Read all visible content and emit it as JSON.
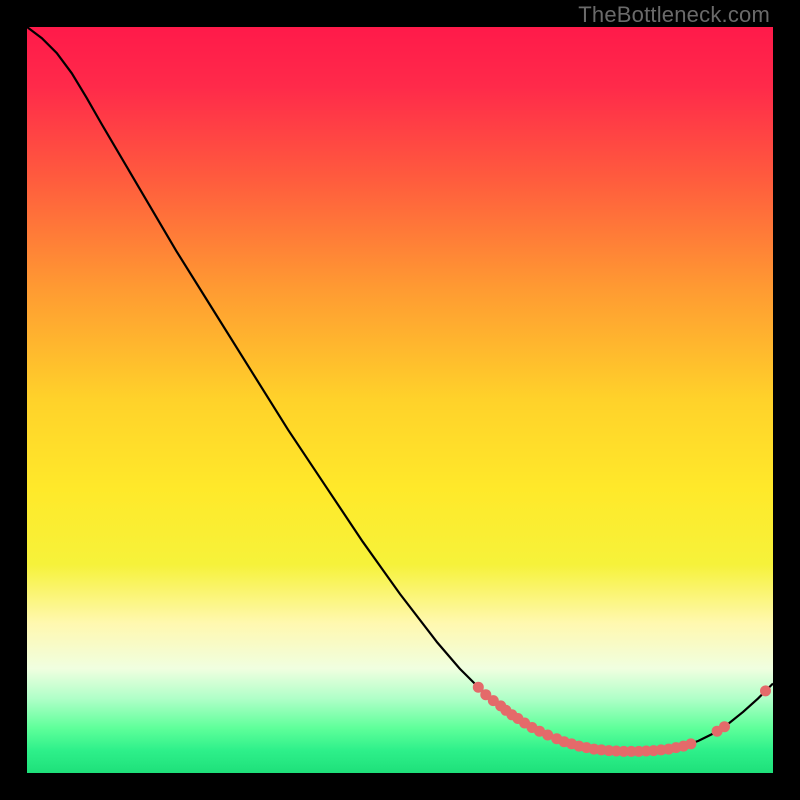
{
  "watermark": "TheBottleneck.com",
  "chart_data": {
    "type": "line",
    "title": "",
    "xlabel": "",
    "ylabel": "",
    "xlim": [
      0,
      100
    ],
    "ylim": [
      0,
      100
    ],
    "grid": false,
    "gradient_stops": [
      {
        "offset": 0.0,
        "color": "#ff1a4a"
      },
      {
        "offset": 0.08,
        "color": "#ff2a4a"
      },
      {
        "offset": 0.2,
        "color": "#ff5a3e"
      },
      {
        "offset": 0.35,
        "color": "#ff9a32"
      },
      {
        "offset": 0.5,
        "color": "#ffd22a"
      },
      {
        "offset": 0.62,
        "color": "#ffe92a"
      },
      {
        "offset": 0.72,
        "color": "#f6f23a"
      },
      {
        "offset": 0.8,
        "color": "#fff8b0"
      },
      {
        "offset": 0.86,
        "color": "#f0ffe0"
      },
      {
        "offset": 0.9,
        "color": "#b0ffc8"
      },
      {
        "offset": 0.94,
        "color": "#5eff9a"
      },
      {
        "offset": 0.97,
        "color": "#2ef08a"
      },
      {
        "offset": 1.0,
        "color": "#1ee07a"
      }
    ],
    "series": [
      {
        "name": "curve",
        "points": [
          {
            "x": 0.0,
            "y": 100.0
          },
          {
            "x": 2.0,
            "y": 98.5
          },
          {
            "x": 4.0,
            "y": 96.5
          },
          {
            "x": 6.0,
            "y": 93.8
          },
          {
            "x": 8.0,
            "y": 90.5
          },
          {
            "x": 10.0,
            "y": 87.0
          },
          {
            "x": 15.0,
            "y": 78.5
          },
          {
            "x": 20.0,
            "y": 70.0
          },
          {
            "x": 25.0,
            "y": 62.0
          },
          {
            "x": 30.0,
            "y": 54.0
          },
          {
            "x": 35.0,
            "y": 46.0
          },
          {
            "x": 40.0,
            "y": 38.5
          },
          {
            "x": 45.0,
            "y": 31.0
          },
          {
            "x": 50.0,
            "y": 24.0
          },
          {
            "x": 55.0,
            "y": 17.5
          },
          {
            "x": 58.0,
            "y": 14.0
          },
          {
            "x": 60.0,
            "y": 12.0
          },
          {
            "x": 62.0,
            "y": 10.2
          },
          {
            "x": 64.0,
            "y": 8.6
          },
          {
            "x": 66.0,
            "y": 7.2
          },
          {
            "x": 68.0,
            "y": 6.0
          },
          {
            "x": 70.0,
            "y": 5.0
          },
          {
            "x": 72.0,
            "y": 4.2
          },
          {
            "x": 74.0,
            "y": 3.6
          },
          {
            "x": 76.0,
            "y": 3.2
          },
          {
            "x": 78.0,
            "y": 3.0
          },
          {
            "x": 80.0,
            "y": 2.9
          },
          {
            "x": 82.0,
            "y": 2.9
          },
          {
            "x": 84.0,
            "y": 3.0
          },
          {
            "x": 86.0,
            "y": 3.2
          },
          {
            "x": 88.0,
            "y": 3.6
          },
          {
            "x": 90.0,
            "y": 4.3
          },
          {
            "x": 92.0,
            "y": 5.3
          },
          {
            "x": 94.0,
            "y": 6.6
          },
          {
            "x": 96.0,
            "y": 8.2
          },
          {
            "x": 98.0,
            "y": 10.0
          },
          {
            "x": 100.0,
            "y": 12.0
          }
        ]
      }
    ],
    "markers": [
      {
        "x": 60.5,
        "y": 11.5
      },
      {
        "x": 61.5,
        "y": 10.5
      },
      {
        "x": 62.5,
        "y": 9.7
      },
      {
        "x": 63.5,
        "y": 9.0
      },
      {
        "x": 64.2,
        "y": 8.4
      },
      {
        "x": 65.0,
        "y": 7.8
      },
      {
        "x": 65.8,
        "y": 7.3
      },
      {
        "x": 66.7,
        "y": 6.7
      },
      {
        "x": 67.7,
        "y": 6.1
      },
      {
        "x": 68.7,
        "y": 5.6
      },
      {
        "x": 69.8,
        "y": 5.1
      },
      {
        "x": 71.0,
        "y": 4.6
      },
      {
        "x": 72.0,
        "y": 4.2
      },
      {
        "x": 73.0,
        "y": 3.9
      },
      {
        "x": 74.0,
        "y": 3.6
      },
      {
        "x": 75.0,
        "y": 3.4
      },
      {
        "x": 76.0,
        "y": 3.2
      },
      {
        "x": 77.0,
        "y": 3.1
      },
      {
        "x": 78.0,
        "y": 3.0
      },
      {
        "x": 79.0,
        "y": 2.95
      },
      {
        "x": 80.0,
        "y": 2.9
      },
      {
        "x": 81.0,
        "y": 2.9
      },
      {
        "x": 82.0,
        "y": 2.9
      },
      {
        "x": 83.0,
        "y": 2.95
      },
      {
        "x": 84.0,
        "y": 3.0
      },
      {
        "x": 85.0,
        "y": 3.1
      },
      {
        "x": 86.0,
        "y": 3.2
      },
      {
        "x": 87.0,
        "y": 3.4
      },
      {
        "x": 88.0,
        "y": 3.6
      },
      {
        "x": 89.0,
        "y": 3.9
      },
      {
        "x": 92.5,
        "y": 5.6
      },
      {
        "x": 93.5,
        "y": 6.2
      },
      {
        "x": 99.0,
        "y": 11.0
      }
    ],
    "marker_color": "#e46a6a",
    "line_color": "#000000"
  }
}
